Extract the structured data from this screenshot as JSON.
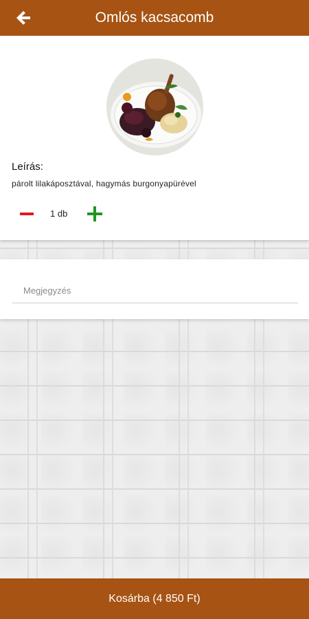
{
  "header": {
    "title": "Omlós kacsacomb",
    "back_icon": "arrow-left-icon"
  },
  "product": {
    "image_icon": "dish-photo",
    "description_label": "Leírás:",
    "description": "párolt lilakáposztával, hagymás burgonyapürével"
  },
  "quantity": {
    "value": "1 db",
    "minus_icon": "minus-icon",
    "plus_icon": "plus-icon"
  },
  "note": {
    "placeholder": "Megjegyzés",
    "value": ""
  },
  "cart": {
    "label": "Kosárba (4 850 Ft)"
  },
  "colors": {
    "brand": "#a65313",
    "minus": "#e0191f",
    "plus": "#239423"
  }
}
